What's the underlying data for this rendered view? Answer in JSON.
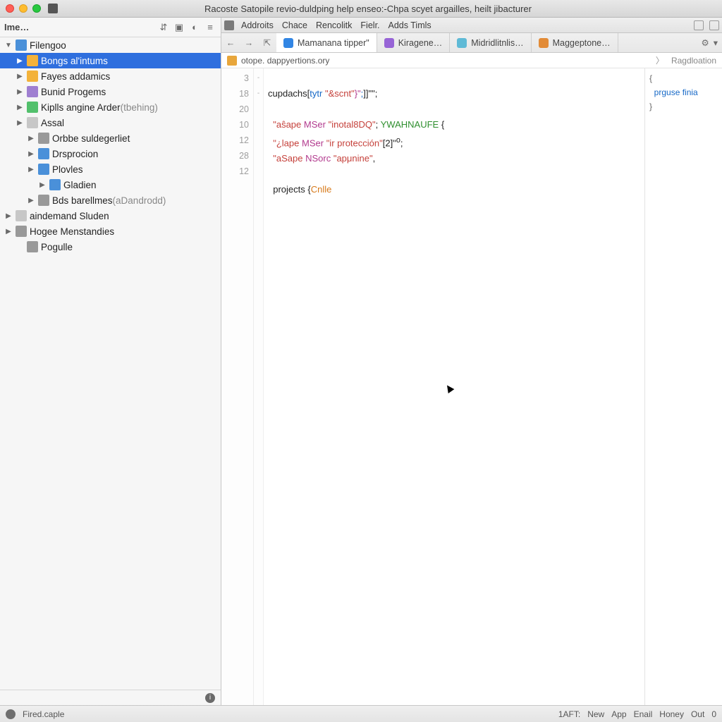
{
  "titlebar": {
    "title": "Racoste Satopile revio-duldping help enseo:-Chpa scyet argailles, heilt jibacturer"
  },
  "sidebar": {
    "header": "Ime…",
    "nodes": [
      {
        "indent": 0,
        "arrow": "▼",
        "icon": "fblue",
        "label": "Filengoo",
        "selected": false
      },
      {
        "indent": 1,
        "arrow": "▶",
        "icon": "fyellow",
        "label": "Bongs al'intums",
        "selected": true
      },
      {
        "indent": 1,
        "arrow": "▶",
        "icon": "fyellow",
        "label": "Fayes addamics"
      },
      {
        "indent": 1,
        "arrow": "▶",
        "icon": "fpurple",
        "label": "Bunid Progems"
      },
      {
        "indent": 1,
        "arrow": "▶",
        "icon": "fgreen",
        "label": "Kiplls angine Arder",
        "extra": "(tbehing)"
      },
      {
        "indent": 1,
        "arrow": "▶",
        "icon": "folder",
        "label": "Assal"
      },
      {
        "indent": 2,
        "arrow": "▶",
        "icon": "fgrey",
        "label": "Orbbe suldegerliet"
      },
      {
        "indent": 2,
        "arrow": "▶",
        "icon": "fblue",
        "label": "Drsprocion"
      },
      {
        "indent": 2,
        "arrow": "▶",
        "icon": "fblue",
        "label": "Plovles"
      },
      {
        "indent": 3,
        "arrow": "▶",
        "icon": "fblue",
        "label": "Gladien"
      },
      {
        "indent": 2,
        "arrow": "▶",
        "icon": "fgrey",
        "label": "Bds barellmes",
        "extra": "(aDandrodd)"
      },
      {
        "indent": 0,
        "arrow": "▶",
        "icon": "folder",
        "label": "aindemand Sluden"
      },
      {
        "indent": 0,
        "arrow": "▶",
        "icon": "fgrey",
        "label": "Hogee Menstandies"
      },
      {
        "indent": 1,
        "arrow": "",
        "icon": "fgrey",
        "label": "Pogulle"
      }
    ]
  },
  "menubar": {
    "items": [
      "Addroits",
      "Chace",
      "Rencolitk",
      "Fielr.",
      "Adds Timls"
    ]
  },
  "tabs": [
    {
      "icon": "blue",
      "label": "Mamanana tipper\"",
      "active": true
    },
    {
      "icon": "purple",
      "label": "Kiragene…"
    },
    {
      "icon": "cyan",
      "label": "Midridlitnlis…"
    },
    {
      "icon": "orange",
      "label": "Maggeptone…"
    }
  ],
  "breadcrumb": {
    "path": "otope. dappyertions.ory",
    "right": "Ragdloation"
  },
  "gutter": [
    "3",
    "18",
    "20",
    "10",
    "12",
    "28",
    "",
    "12",
    ""
  ],
  "fold": [
    "",
    "-",
    "",
    "",
    "",
    "-",
    "",
    "",
    ""
  ],
  "code": {
    "lines": [
      {
        "html": "cupdachs[<span class='id'>tytr</span> <span class='str'>\"&scnt\"</span><span class='kw'>}\"</span><span class='num'>;</span>]]\"\";"
      },
      {
        "html": ""
      },
      {
        "html": "  <span class='str'>\"aŝape</span> <span class='kw'>MSer</span> <span class='str'>\"inotal8DQ\"</span>; <span class='macro'>YWAHNAUFE</span> {"
      },
      {
        "html": "  <span class='str'>\"¿lape</span> <span class='kw'>MSer</span> <span class='str'>\"ir protección\"</span>[2]\"<sup>o</sup>;"
      },
      {
        "html": "  <span class='str'>\"aSape</span> <span class='kw'>NSorc</span> <span class='str'>\"apμnine\"</span>,",
        "current": true
      },
      {
        "html": ""
      },
      {
        "html": "  projects {<span class='func'>Cnlle</span>"
      }
    ]
  },
  "minimap": {
    "l1": "{",
    "l2": "prguse finia",
    "l3": "}"
  },
  "status": {
    "left": "Fired.caple",
    "items": [
      "1AFT:",
      "New",
      "App",
      "Enail",
      "Honey",
      "Out",
      "0"
    ]
  }
}
